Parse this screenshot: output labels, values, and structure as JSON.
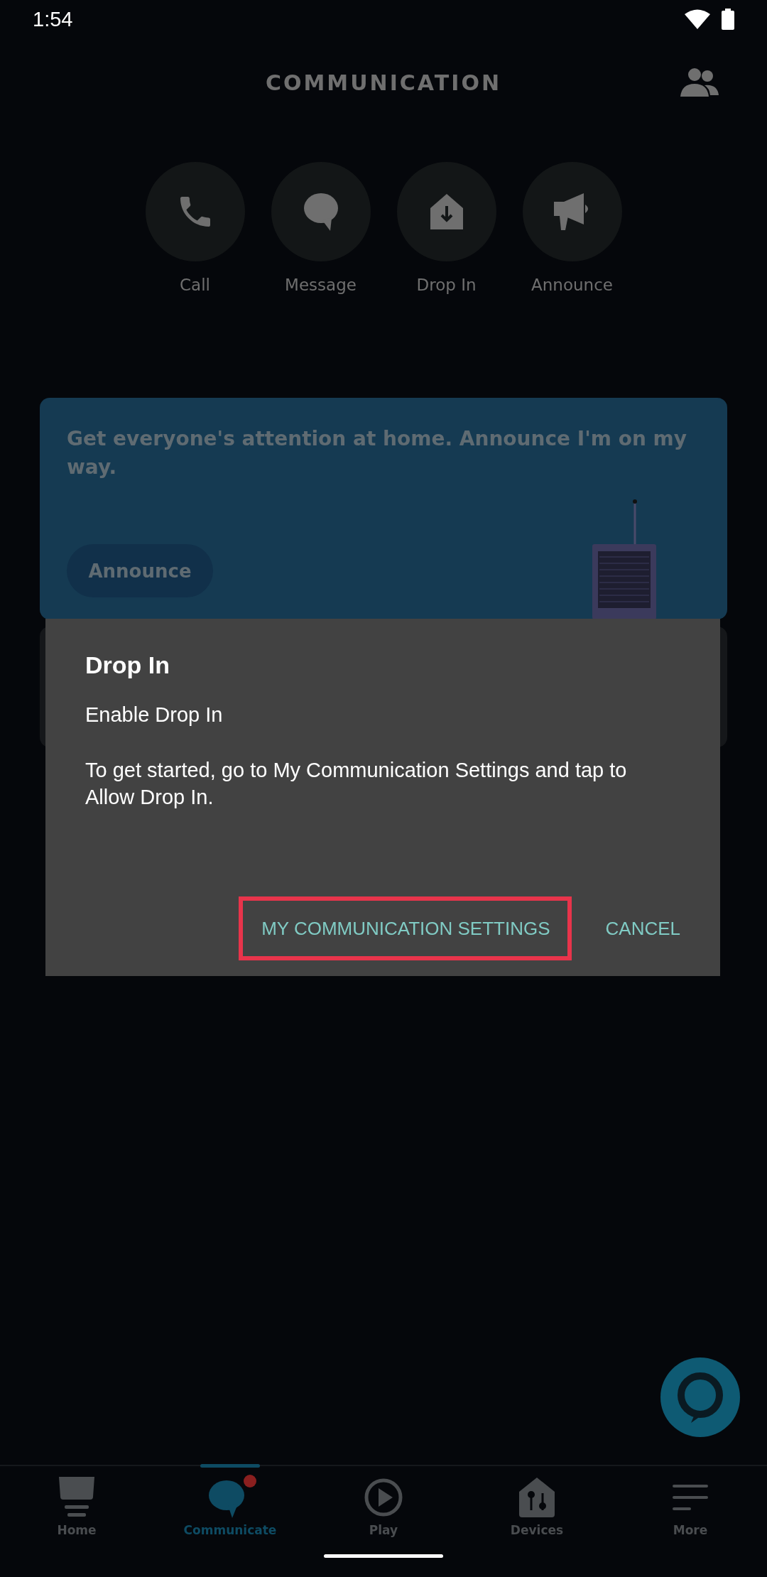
{
  "status_bar": {
    "time": "1:54"
  },
  "header": {
    "title": "COMMUNICATION"
  },
  "actions": [
    {
      "label": "Call",
      "kind": "call"
    },
    {
      "label": "Message",
      "kind": "message"
    },
    {
      "label": "Drop In",
      "kind": "dropin"
    },
    {
      "label": "Announce",
      "kind": "announce"
    }
  ],
  "promo_card": {
    "text": "Get everyone's attention at home. Announce I'm on my way.",
    "button": "Announce"
  },
  "dialog": {
    "title": "Drop In",
    "subtitle": "Enable Drop In",
    "body": "To get started, go to My Communication Settings and tap to Allow Drop In.",
    "buttons": [
      {
        "label": "MY COMMUNICATION SETTINGS",
        "highlighted": true
      },
      {
        "label": "CANCEL",
        "highlighted": false
      }
    ]
  },
  "bottom_nav": [
    {
      "label": "Home",
      "kind": "home",
      "selected": false,
      "badge": false
    },
    {
      "label": "Communicate",
      "kind": "communicate",
      "selected": true,
      "badge": true
    },
    {
      "label": "Play",
      "kind": "play",
      "selected": false,
      "badge": false
    },
    {
      "label": "Devices",
      "kind": "devices",
      "selected": false,
      "badge": false
    },
    {
      "label": "More",
      "kind": "more",
      "selected": false,
      "badge": false
    }
  ]
}
